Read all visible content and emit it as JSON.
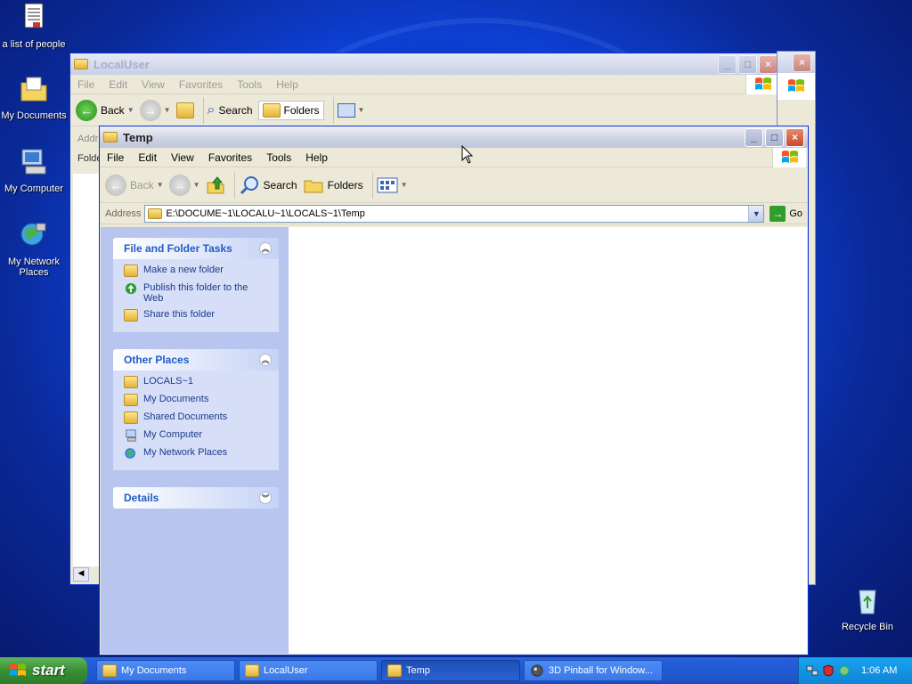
{
  "desktop": {
    "icons": [
      {
        "label": "a list of people"
      },
      {
        "label": "My Documents"
      },
      {
        "label": "My Computer"
      },
      {
        "label": "My Network Places"
      },
      {
        "label": "Recycle Bin"
      }
    ]
  },
  "back_window": {
    "title": "LocalUser",
    "menu": [
      "File",
      "Edit",
      "View",
      "Favorites",
      "Tools",
      "Help"
    ],
    "toolbar": {
      "back": "Back",
      "search": "Search",
      "folders": "Folders"
    },
    "address_label": "Addr",
    "folders_label": "Folde"
  },
  "front_window": {
    "title": "Temp",
    "menu": [
      "File",
      "Edit",
      "View",
      "Favorites",
      "Tools",
      "Help"
    ],
    "toolbar": {
      "back": "Back",
      "search": "Search",
      "folders": "Folders"
    },
    "address": {
      "label": "Address",
      "value": "E:\\DOCUME~1\\LOCALU~1\\LOCALS~1\\Temp",
      "go": "Go"
    },
    "taskpane": {
      "file_tasks": {
        "title": "File and Folder Tasks",
        "items": [
          "Make a new folder",
          "Publish this folder to the Web",
          "Share this folder"
        ]
      },
      "other_places": {
        "title": "Other Places",
        "items": [
          "LOCALS~1",
          "My Documents",
          "Shared Documents",
          "My Computer",
          "My Network Places"
        ]
      },
      "details": {
        "title": "Details"
      }
    }
  },
  "taskbar": {
    "start": "start",
    "buttons": [
      "My Documents",
      "LocalUser",
      "Temp",
      "3D Pinball for Window..."
    ],
    "active_index": 2,
    "clock": "1:06 AM"
  }
}
